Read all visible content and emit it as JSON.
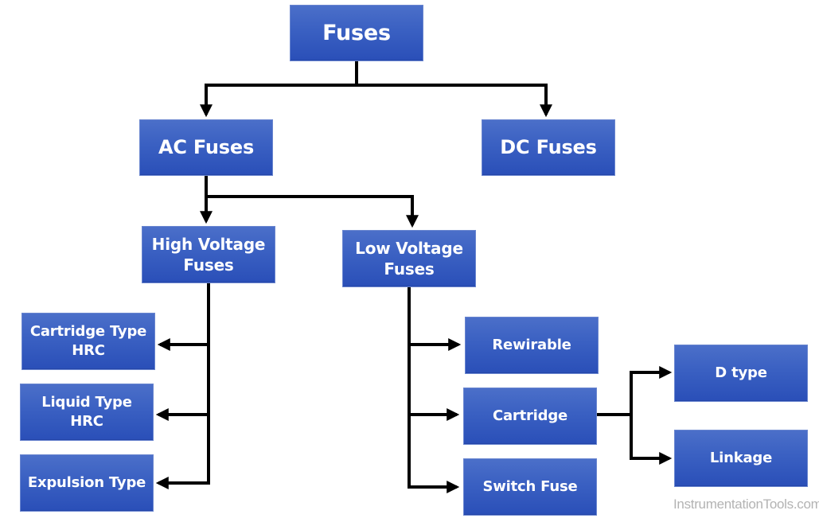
{
  "diagram": {
    "title": "Fuses",
    "nodes": {
      "fuses": "Fuses",
      "ac_fuses": "AC Fuses",
      "dc_fuses": "DC Fuses",
      "high_voltage": {
        "line1": "High Voltage",
        "line2": "Fuses"
      },
      "low_voltage": {
        "line1": "Low Voltage",
        "line2": "Fuses"
      },
      "cartridge_hrc": {
        "line1": "Cartridge Type",
        "line2": "HRC"
      },
      "liquid_hrc": {
        "line1": "Liquid Type",
        "line2": "HRC"
      },
      "expulsion": "Expulsion Type",
      "rewirable": "Rewirable",
      "cartridge": "Cartridge",
      "switch_fuse": "Switch Fuse",
      "d_type": "D type",
      "linkage": "Linkage"
    },
    "edges": [
      [
        "fuses",
        "ac_fuses"
      ],
      [
        "fuses",
        "dc_fuses"
      ],
      [
        "ac_fuses",
        "high_voltage"
      ],
      [
        "ac_fuses",
        "low_voltage"
      ],
      [
        "high_voltage",
        "cartridge_hrc"
      ],
      [
        "high_voltage",
        "liquid_hrc"
      ],
      [
        "high_voltage",
        "expulsion"
      ],
      [
        "low_voltage",
        "rewirable"
      ],
      [
        "low_voltage",
        "cartridge"
      ],
      [
        "low_voltage",
        "switch_fuse"
      ],
      [
        "cartridge",
        "d_type"
      ],
      [
        "cartridge",
        "linkage"
      ]
    ],
    "colors": {
      "box_top": "#4b6fc9",
      "box_bottom": "#2a4fb8",
      "text": "#ffffff",
      "connector": "#000000",
      "watermark": "#b3b3b3"
    }
  },
  "watermark": "InstrumentationTools.com"
}
